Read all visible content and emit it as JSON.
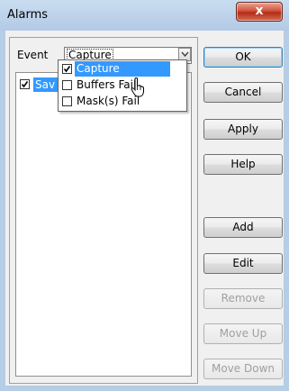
{
  "window": {
    "title": "Alarms",
    "close_glyph": "x"
  },
  "event": {
    "label": "Event",
    "selected_value": "Capture",
    "dropdown_options": [
      {
        "label": "Capture",
        "checked": true,
        "highlighted": true
      },
      {
        "label": "Buffers Fail",
        "checked": false,
        "highlighted": false
      },
      {
        "label": "Mask(s) Fail",
        "checked": false,
        "highlighted": false
      }
    ]
  },
  "list": {
    "items": [
      {
        "label": "Sav",
        "checked": true,
        "selected": true
      }
    ]
  },
  "buttons": {
    "ok": "OK",
    "cancel": "Cancel",
    "apply": "Apply",
    "help": "Help",
    "add": "Add",
    "edit": "Edit",
    "remove": "Remove",
    "move_up": "Move Up",
    "move_down": "Move Down"
  },
  "colors": {
    "selection": "#3399ff",
    "close_button": "#c8442b",
    "frame": "#b6cde6"
  }
}
